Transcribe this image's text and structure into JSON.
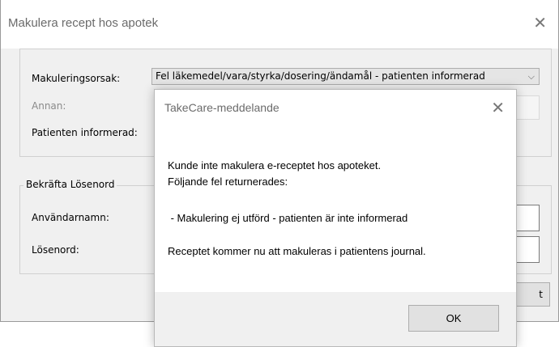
{
  "main_dialog": {
    "title": "Makulera recept hos apotek",
    "reason_label": "Makuleringsorsak:",
    "reason_value": "Fel läkemedel/vara/styrka/dosering/ändamål - patienten informerad",
    "other_label": "Annan:",
    "informed_label": "Patienten informerad:",
    "confirm_group_title": "Bekräfta Lösenord",
    "username_label": "Användarnamn:",
    "password_label": "Lösenord:",
    "confirm_button_label": "t"
  },
  "modal": {
    "title": "TakeCare-meddelande",
    "message_line1": "Kunde inte makulera e-receptet hos apoteket.",
    "message_line2": "Följande fel returnerades:",
    "message_line3": " - Makulering ej utförd - patienten är inte informerad",
    "message_line4": "Receptet kommer nu att makuleras i patientens journal.",
    "ok_label": "OK"
  },
  "icons": {
    "close": "close-icon",
    "dropdown": "chevron-down-icon"
  }
}
